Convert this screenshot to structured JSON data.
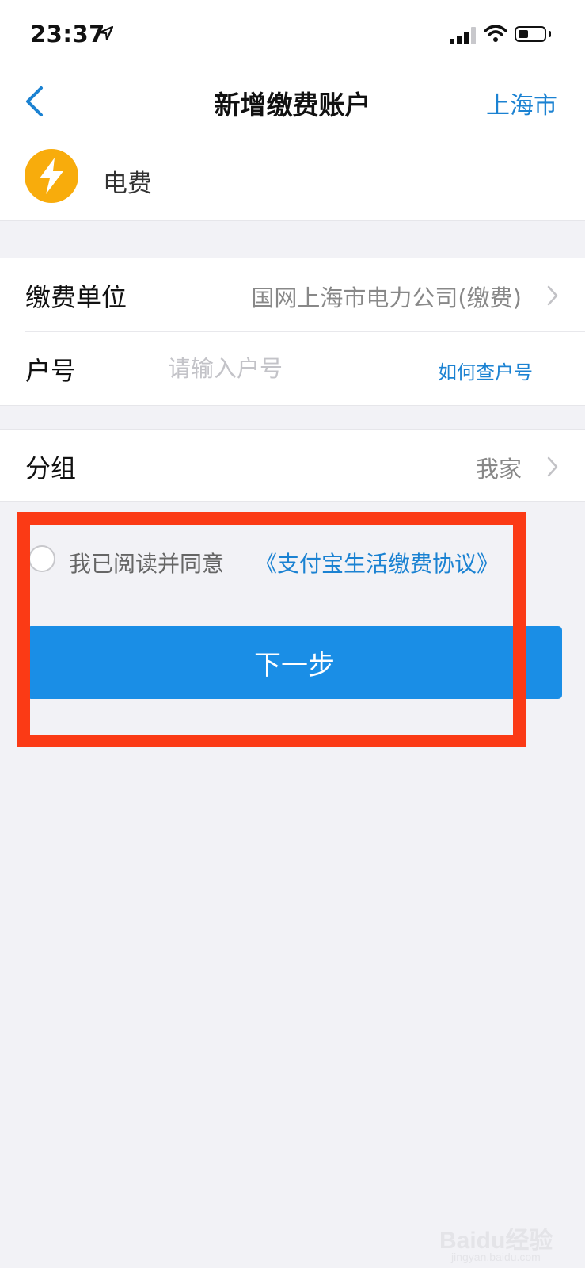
{
  "status_bar": {
    "time": "23:37"
  },
  "nav": {
    "title": "新增缴费账户",
    "city": "上海市"
  },
  "biller": {
    "name": "电费",
    "icon": "lightning-bolt-icon",
    "icon_color": "#f8ac0c"
  },
  "form": {
    "unit_label": "缴费单位",
    "unit_value": "国网上海市电力公司(缴费)",
    "account_label": "户号",
    "account_placeholder": "请输入户号",
    "account_value": "",
    "account_help": "如何查户号",
    "group_label": "分组",
    "group_value": "我家"
  },
  "agreement": {
    "text": "我已阅读并同意",
    "link": "《支付宝生活缴费协议》",
    "checked": false
  },
  "next_button": {
    "label": "下一步",
    "color": "#1a8ee6"
  },
  "annotation": {
    "color": "#fb3a15"
  },
  "watermark": {
    "text": "Baidu经验",
    "sub": "jingyan.baidu.com"
  },
  "colors": {
    "accent": "#1b82d2",
    "background": "#f2f2f6"
  }
}
